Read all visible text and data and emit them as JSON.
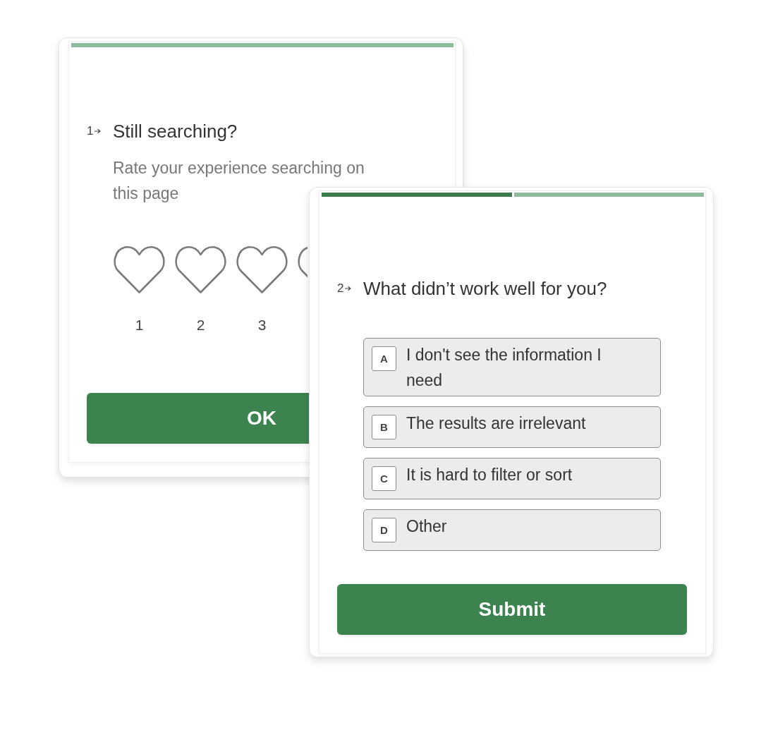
{
  "cards": [
    {
      "progress": [
        {
          "done": false
        }
      ],
      "number": "1",
      "title": "Still searching?",
      "kind": "rating",
      "description": "Rate your experience searching on this page",
      "rating": {
        "stars": 0,
        "options": [
          {
            "kind": "labeled",
            "label": "1"
          },
          {
            "kind": "labeled",
            "label": "2"
          },
          {
            "kind": "labeled",
            "label": "3"
          },
          {
            "kind": "partial"
          }
        ]
      },
      "button": "OK"
    },
    {
      "progress": [
        {
          "done": true
        },
        {
          "done": false
        }
      ],
      "number": "2",
      "title": "What didn’t work well for you?",
      "kind": "choice",
      "choices": [
        {
          "key": "A",
          "label": "I don't see the information I need",
          "selected": false
        },
        {
          "key": "B",
          "label": "The results are irrelevant",
          "selected": false
        },
        {
          "key": "C",
          "label": "It is hard to filter or sort",
          "selected": false
        },
        {
          "key": "D",
          "label": "Other",
          "selected": false
        }
      ],
      "button": "Submit"
    }
  ]
}
